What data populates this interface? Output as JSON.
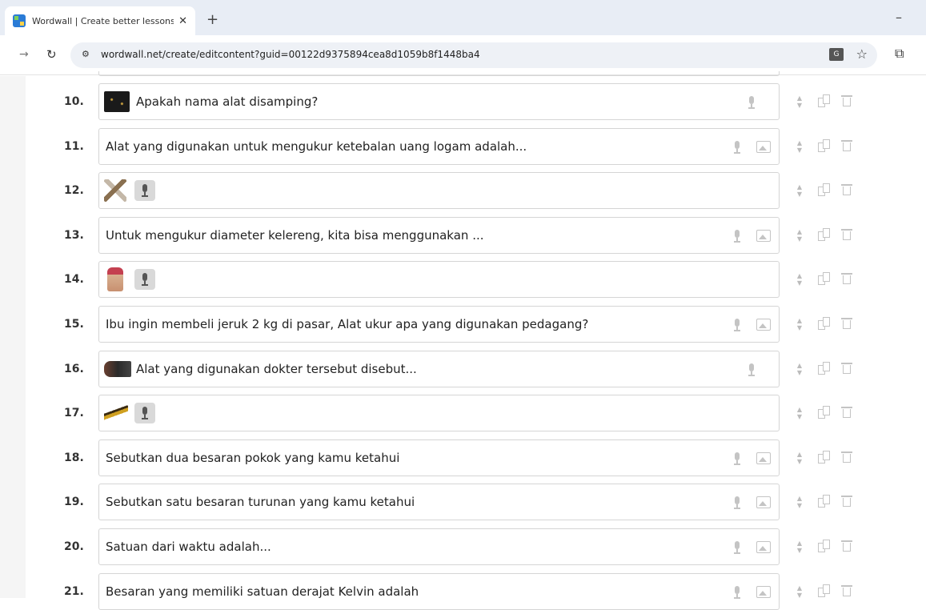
{
  "browser": {
    "tab_title": "Wordwall | Create better lessons",
    "tab_close": "✕",
    "new_tab": "+",
    "minimize": "–",
    "url": "wordwall.net/create/editcontent?guid=00122d9375894cea8d1059b8f1448ba4",
    "translate_label": "G"
  },
  "rows": [
    {
      "number": "10.",
      "text": "Apakah nama alat disamping?",
      "thumb": "stars",
      "image_icon": false,
      "mic_button": false
    },
    {
      "number": "11.",
      "text": "Alat yang digunakan untuk mengukur ketebalan uang logam adalah...",
      "thumb": null,
      "image_icon": true,
      "mic_button": false
    },
    {
      "number": "12.",
      "text": "",
      "thumb": "tool",
      "image_icon": false,
      "mic_button": true
    },
    {
      "number": "13.",
      "text": "Untuk mengukur diameter kelereng, kita bisa menggunakan ...",
      "thumb": null,
      "image_icon": true,
      "mic_button": false
    },
    {
      "number": "14.",
      "text": "",
      "thumb": "hand",
      "image_icon": false,
      "mic_button": true
    },
    {
      "number": "15.",
      "text": "Ibu ingin membeli jeruk 2 kg di pasar, Alat ukur apa yang digunakan pedagang?",
      "thumb": null,
      "image_icon": true,
      "mic_button": false
    },
    {
      "number": "16.",
      "text": "Alat yang digunakan dokter tersebut disebut...",
      "thumb": "dark",
      "image_icon": false,
      "mic_button": false
    },
    {
      "number": "17.",
      "text": "",
      "thumb": "key",
      "image_icon": false,
      "mic_button": true
    },
    {
      "number": "18.",
      "text": "Sebutkan dua besaran pokok yang kamu ketahui",
      "thumb": null,
      "image_icon": true,
      "mic_button": false
    },
    {
      "number": "19.",
      "text": "Sebutkan satu besaran turunan yang kamu ketahui",
      "thumb": null,
      "image_icon": true,
      "mic_button": false
    },
    {
      "number": "20.",
      "text": "Satuan dari waktu adalah...",
      "thumb": null,
      "image_icon": true,
      "mic_button": false
    },
    {
      "number": "21.",
      "text": "Besaran yang memiliki satuan derajat Kelvin adalah",
      "thumb": null,
      "image_icon": true,
      "mic_button": false
    }
  ]
}
